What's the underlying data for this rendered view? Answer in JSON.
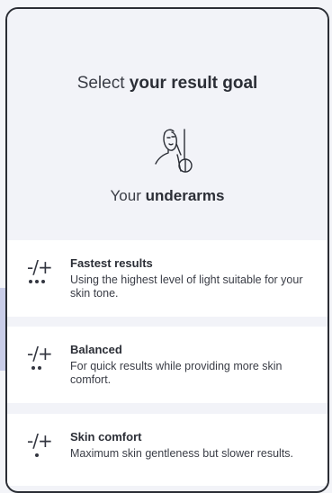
{
  "header": {
    "title_prefix": "Select ",
    "title_bold": "your result goal",
    "area_prefix": "Your ",
    "area_bold": "underarms"
  },
  "options": [
    {
      "icon": "intensity-high-icon",
      "symbol": "-/+",
      "dots": 3,
      "title": "Fastest results",
      "description": "Using the highest level of light suitable for your skin tone."
    },
    {
      "icon": "intensity-medium-icon",
      "symbol": "-/+",
      "dots": 2,
      "title": "Balanced",
      "description": "For quick results while providing more skin comfort."
    },
    {
      "icon": "intensity-low-icon",
      "symbol": "-/+",
      "dots": 1,
      "title": "Skin comfort",
      "description": "Maximum skin gentleness but slower results."
    }
  ],
  "colors": {
    "background": "#f2f3f8",
    "card": "#ffffff",
    "text": "#2b2e36",
    "accent": "#c9cde8"
  }
}
